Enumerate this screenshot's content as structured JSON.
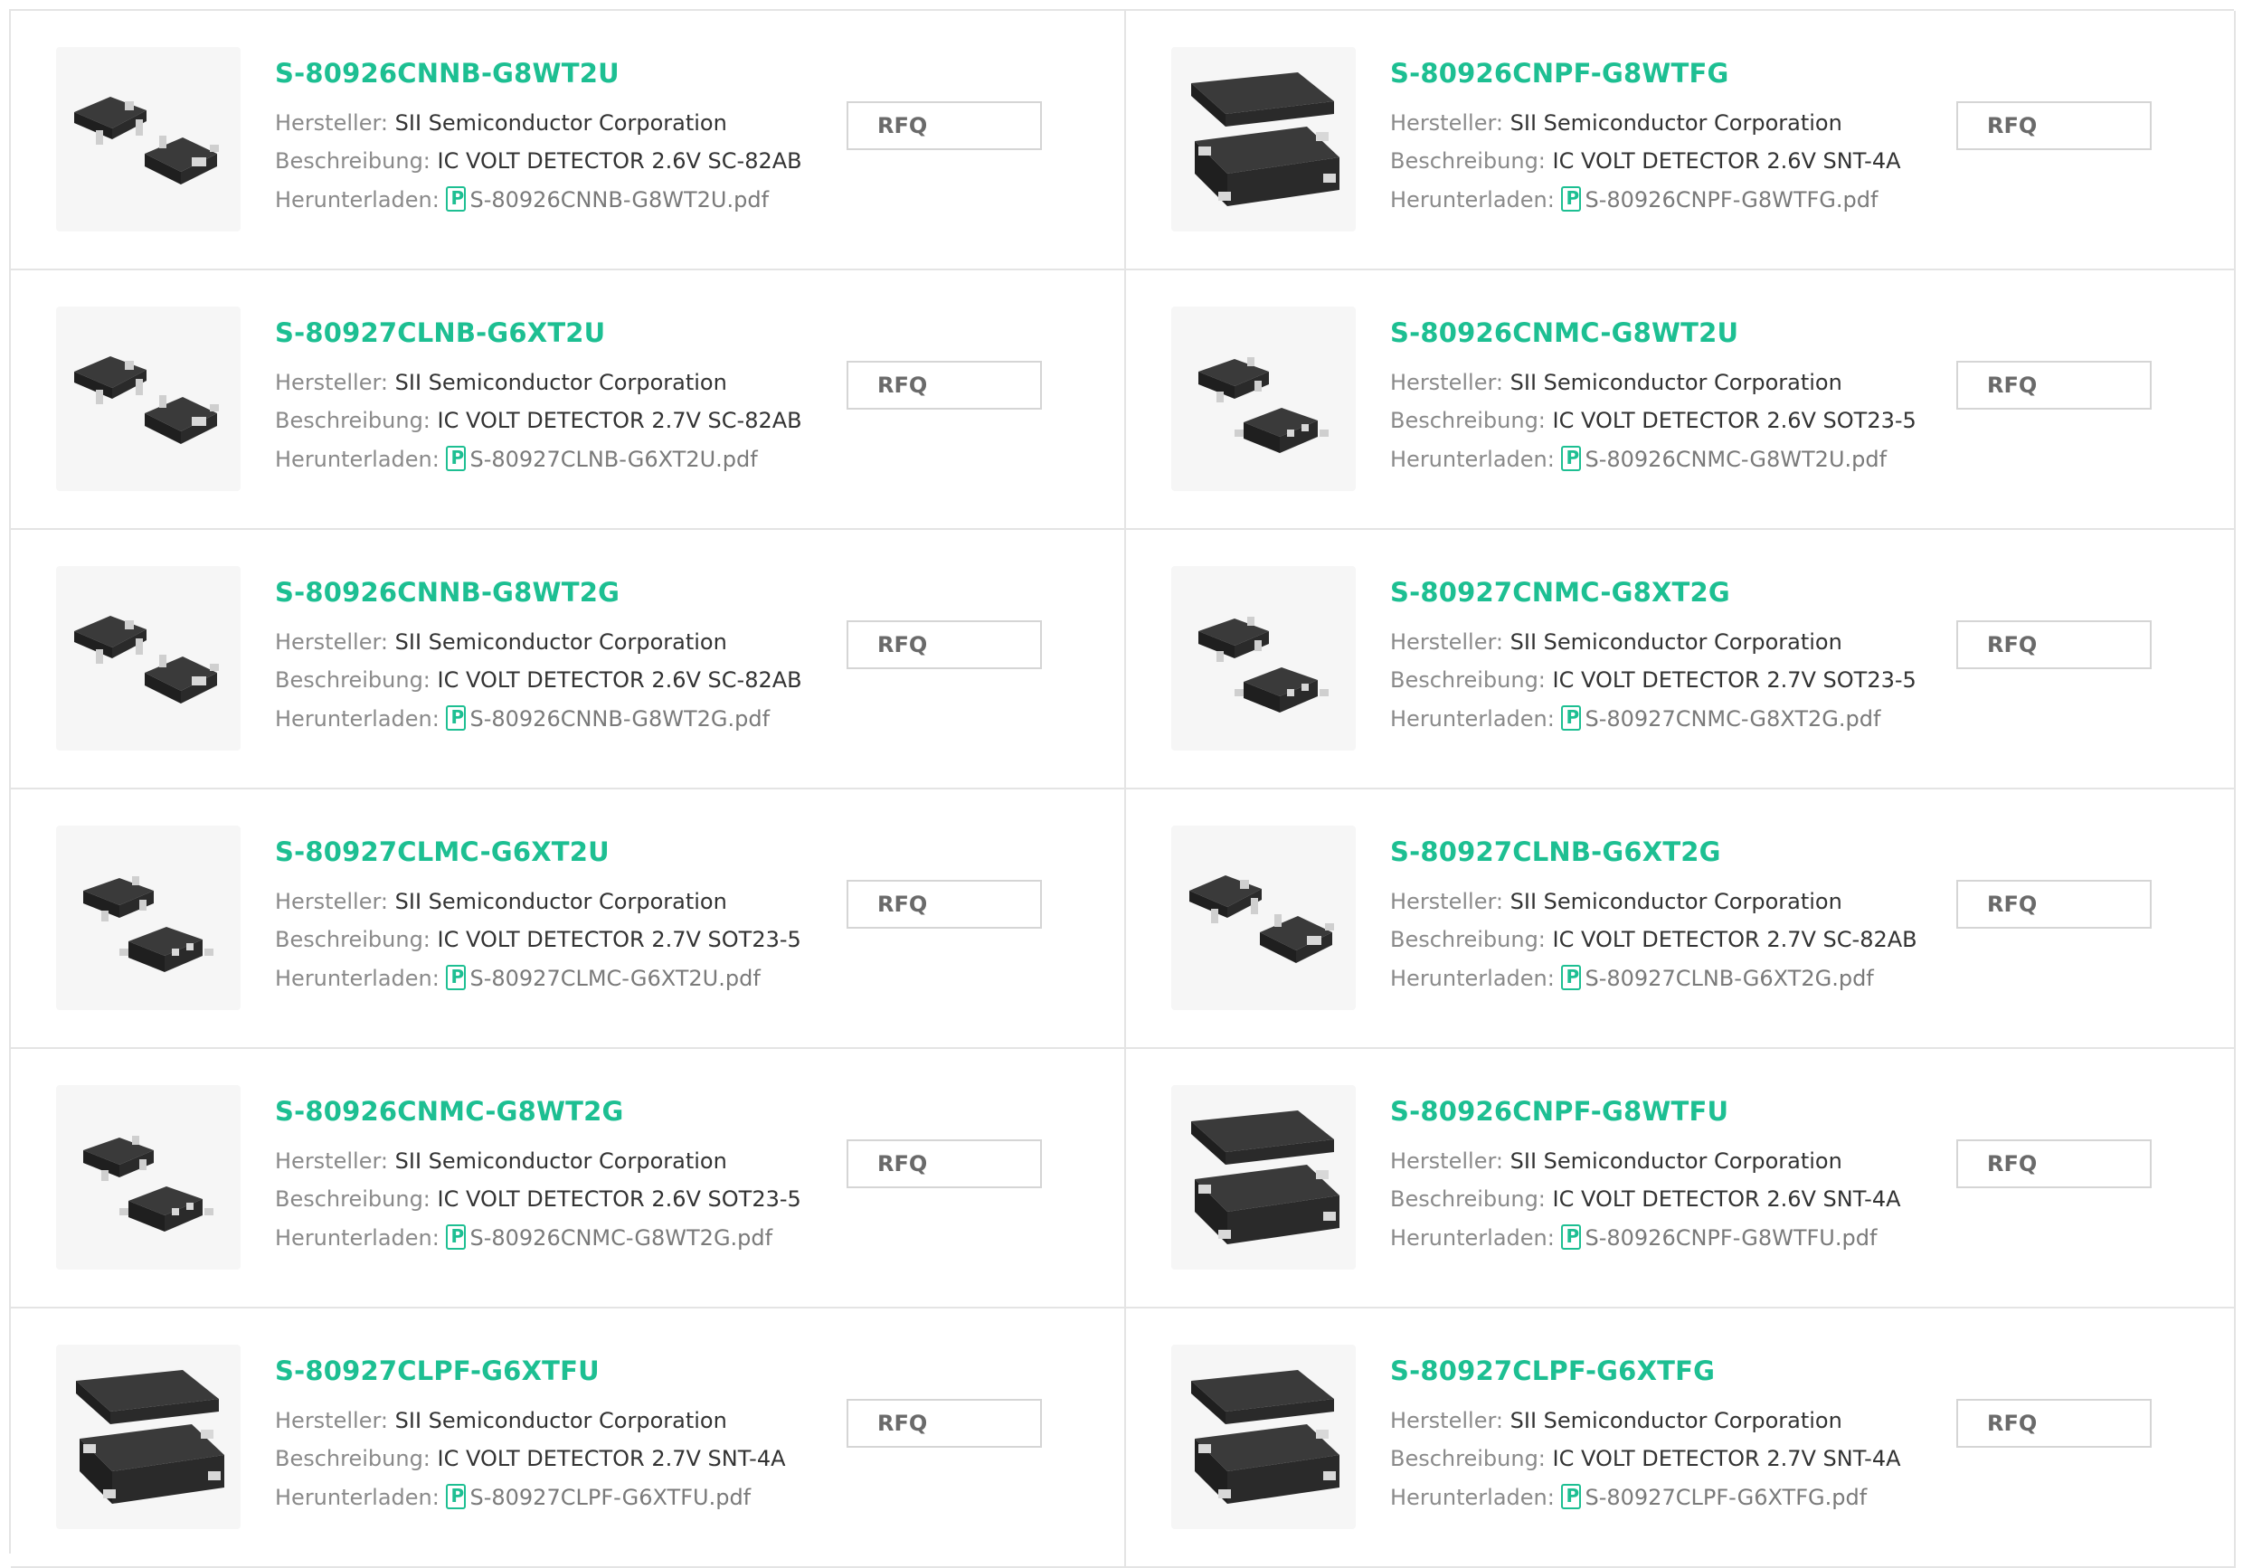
{
  "labels": {
    "manufacturer": "Hersteller:",
    "description": "Beschreibung:",
    "download": "Herunterladen:",
    "rfq": "RFQ"
  },
  "accent_color": "#1dbf92",
  "products": [
    {
      "part": "S-80926CNNB-G8WT2U",
      "manufacturer": "SII Semiconductor Corporation",
      "description": "IC VOLT DETECTOR 2.6V SC-82AB",
      "pdf": "S-80926CNNB-G8WT2U.pdf",
      "package_icon": "sc82ab-package-icon"
    },
    {
      "part": "S-80926CNPF-G8WTFG",
      "manufacturer": "SII Semiconductor Corporation",
      "description": "IC VOLT DETECTOR 2.6V SNT-4A",
      "pdf": "S-80926CNPF-G8WTFG.pdf",
      "package_icon": "snt4a-package-icon"
    },
    {
      "part": "S-80927CLNB-G6XT2U",
      "manufacturer": "SII Semiconductor Corporation",
      "description": "IC VOLT DETECTOR 2.7V SC-82AB",
      "pdf": "S-80927CLNB-G6XT2U.pdf",
      "package_icon": "sc82ab-package-icon"
    },
    {
      "part": "S-80926CNMC-G8WT2U",
      "manufacturer": "SII Semiconductor Corporation",
      "description": "IC VOLT DETECTOR 2.6V SOT23-5",
      "pdf": "S-80926CNMC-G8WT2U.pdf",
      "package_icon": "sot23-package-icon"
    },
    {
      "part": "S-80926CNNB-G8WT2G",
      "manufacturer": "SII Semiconductor Corporation",
      "description": "IC VOLT DETECTOR 2.6V SC-82AB",
      "pdf": "S-80926CNNB-G8WT2G.pdf",
      "package_icon": "sc82ab-package-icon"
    },
    {
      "part": "S-80927CNMC-G8XT2G",
      "manufacturer": "SII Semiconductor Corporation",
      "description": "IC VOLT DETECTOR 2.7V SOT23-5",
      "pdf": "S-80927CNMC-G8XT2G.pdf",
      "package_icon": "sot23-package-icon"
    },
    {
      "part": "S-80927CLMC-G6XT2U",
      "manufacturer": "SII Semiconductor Corporation",
      "description": "IC VOLT DETECTOR 2.7V SOT23-5",
      "pdf": "S-80927CLMC-G6XT2U.pdf",
      "package_icon": "sot23-package-icon"
    },
    {
      "part": "S-80927CLNB-G6XT2G",
      "manufacturer": "SII Semiconductor Corporation",
      "description": "IC VOLT DETECTOR 2.7V SC-82AB",
      "pdf": "S-80927CLNB-G6XT2G.pdf",
      "package_icon": "sc82ab-package-icon"
    },
    {
      "part": "S-80926CNMC-G8WT2G",
      "manufacturer": "SII Semiconductor Corporation",
      "description": "IC VOLT DETECTOR 2.6V SOT23-5",
      "pdf": "S-80926CNMC-G8WT2G.pdf",
      "package_icon": "sot23-package-icon"
    },
    {
      "part": "S-80926CNPF-G8WTFU",
      "manufacturer": "SII Semiconductor Corporation",
      "description": "IC VOLT DETECTOR 2.6V SNT-4A",
      "pdf": "S-80926CNPF-G8WTFU.pdf",
      "package_icon": "snt4a-package-icon"
    },
    {
      "part": "S-80927CLPF-G6XTFU",
      "manufacturer": "SII Semiconductor Corporation",
      "description": "IC VOLT DETECTOR 2.7V SNT-4A",
      "pdf": "S-80927CLPF-G6XTFU.pdf",
      "package_icon": "snt4a-package-icon"
    },
    {
      "part": "S-80927CLPF-G6XTFG",
      "manufacturer": "SII Semiconductor Corporation",
      "description": "IC VOLT DETECTOR 2.7V SNT-4A",
      "pdf": "S-80927CLPF-G6XTFG.pdf",
      "package_icon": "snt4a-package-icon"
    }
  ]
}
